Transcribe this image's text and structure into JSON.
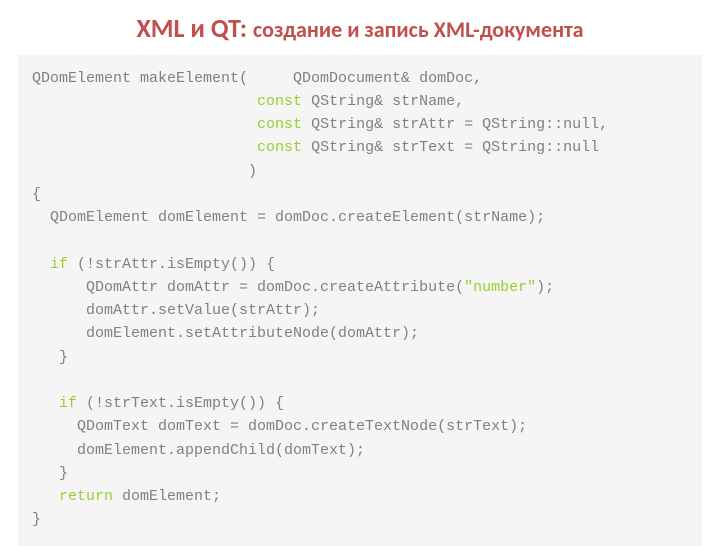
{
  "title_main": "XML и QT:",
  "title_sub": "создание и запись XML-документа",
  "code": {
    "lines": [
      [
        {
          "t": "QDomElement makeElement(     QDomDocument& domDoc,"
        }
      ],
      [
        {
          "t": "                         "
        },
        {
          "t": "const",
          "c": "kw"
        },
        {
          "t": " QString& strName,"
        }
      ],
      [
        {
          "t": "                         "
        },
        {
          "t": "const",
          "c": "kw"
        },
        {
          "t": " QString& strAttr = QString::null,"
        }
      ],
      [
        {
          "t": "                         "
        },
        {
          "t": "const",
          "c": "kw"
        },
        {
          "t": " QString& strText = QString::null"
        }
      ],
      [
        {
          "t": "                        )"
        }
      ],
      [
        {
          "t": "{"
        }
      ],
      [
        {
          "t": "  QDomElement domElement = domDoc.createElement(strName);"
        }
      ],
      [
        {
          "t": ""
        }
      ],
      [
        {
          "t": "  "
        },
        {
          "t": "if",
          "c": "kw"
        },
        {
          "t": " (!strAttr.isEmpty()) {"
        }
      ],
      [
        {
          "t": "      QDomAttr domAttr = domDoc.createAttribute("
        },
        {
          "t": "\"number\"",
          "c": "str"
        },
        {
          "t": ");"
        }
      ],
      [
        {
          "t": "      domAttr.setValue(strAttr);"
        }
      ],
      [
        {
          "t": "      domElement.setAttributeNode(domAttr);"
        }
      ],
      [
        {
          "t": "   }"
        }
      ],
      [
        {
          "t": ""
        }
      ],
      [
        {
          "t": "   "
        },
        {
          "t": "if",
          "c": "kw"
        },
        {
          "t": " (!strText.isEmpty()) {"
        }
      ],
      [
        {
          "t": "     QDomText domText = domDoc.createTextNode(strText);"
        }
      ],
      [
        {
          "t": "     domElement.appendChild(domText);"
        }
      ],
      [
        {
          "t": "   }"
        }
      ],
      [
        {
          "t": "   "
        },
        {
          "t": "return",
          "c": "kw"
        },
        {
          "t": " domElement;"
        }
      ],
      [
        {
          "t": "}"
        }
      ]
    ]
  }
}
